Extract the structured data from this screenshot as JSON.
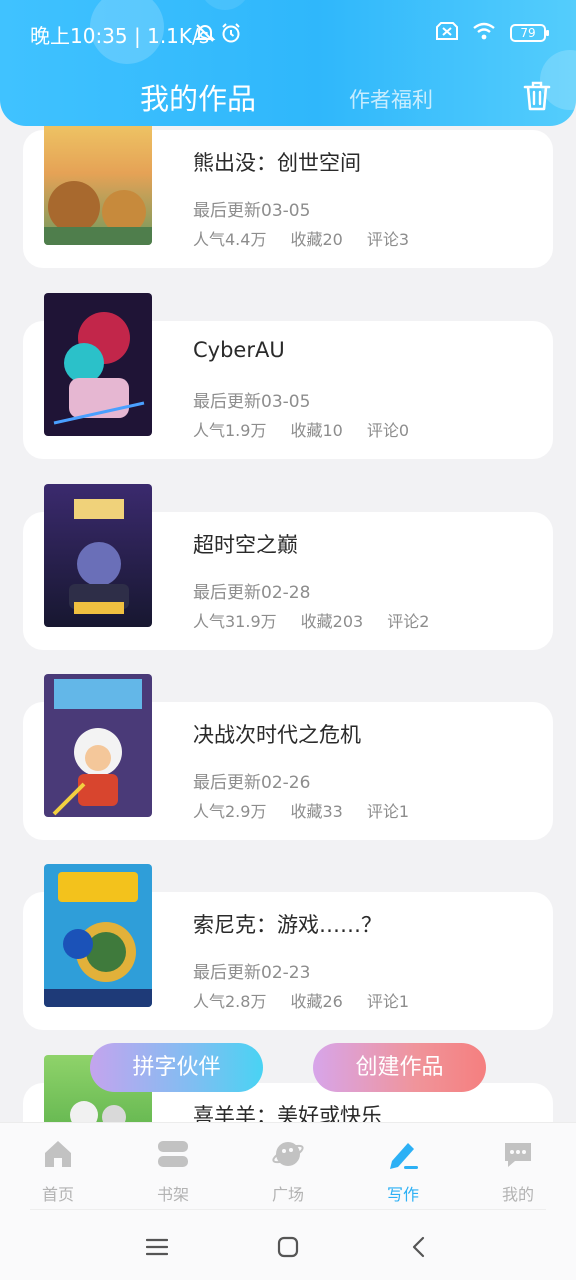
{
  "status_bar": {
    "time": "晚上10:35 | 1.1K/s",
    "battery": "79"
  },
  "header": {
    "tab_active": "我的作品",
    "tab_inactive": "作者福利"
  },
  "works": [
    {
      "title": "熊出没：创世空间",
      "update": "最后更新03-05",
      "popularity": "人气4.4万",
      "favorites": "收藏20",
      "comments": "评论3"
    },
    {
      "title": "CyberAU",
      "update": "最后更新03-05",
      "popularity": "人气1.9万",
      "favorites": "收藏10",
      "comments": "评论0"
    },
    {
      "title": "超时空之巅",
      "update": "最后更新02-28",
      "popularity": "人气31.9万",
      "favorites": "收藏203",
      "comments": "评论2"
    },
    {
      "title": "决战次时代之危机",
      "update": "最后更新02-26",
      "popularity": "人气2.9万",
      "favorites": "收藏33",
      "comments": "评论1"
    },
    {
      "title": "索尼克：游戏……？",
      "update": "最后更新02-23",
      "popularity": "人气2.8万",
      "favorites": "收藏26",
      "comments": "评论1"
    },
    {
      "title": "喜羊羊：美好或快乐",
      "update": "",
      "popularity": "",
      "favorites": "",
      "comments": ""
    }
  ],
  "actions": {
    "partner": "拼字伙伴",
    "create": "创建作品"
  },
  "nav": {
    "home": "首页",
    "shelf": "书架",
    "square": "广场",
    "write": "写作",
    "mine": "我的"
  },
  "colors": {
    "header_blue": "#2fb7fb",
    "active_nav": "#2cb0f5",
    "inactive_nav": "#c2c2c2"
  }
}
